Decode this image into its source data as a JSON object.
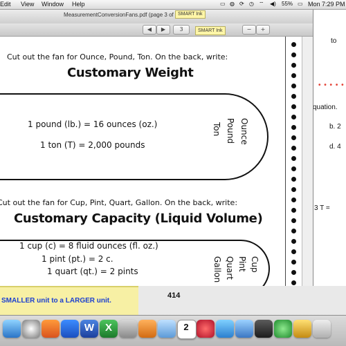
{
  "menubar": {
    "items": [
      "Edit",
      "View",
      "Window",
      "Help"
    ],
    "battery": "55%",
    "clock": "Mon 7:29 PM"
  },
  "background_doc": {
    "frag_top": "to",
    "frag_equation": "quation.",
    "item_b": "b. 2",
    "item_d": "d. 4",
    "frag_3t": "3 T ="
  },
  "window": {
    "title": "MeasurementConversionFans.pdf (page 3 of 12)",
    "smart_ink_tab": "SMART Ink",
    "smart_ink_label": "SMART Ink",
    "toolbar_page_field": "3"
  },
  "page": {
    "weight": {
      "instruction": "Cut out the fan for Ounce, Pound, Ton.  On the back, write:",
      "heading": "Customary Weight",
      "line1": "1 pound (lb.) = 16 ounces (oz.)",
      "line2": "1 ton (T) = 2,000 pounds",
      "tab_words": [
        "Ounce",
        "Pound",
        "Ton"
      ]
    },
    "capacity": {
      "instruction": "Cut out the fan for Cup, Pint, Quart, Gallon.  On the back, write:",
      "heading": "Customary Capacity (Liquid Volume)",
      "line1": "1 cup (c) = 8 fluid ounces (fl. oz.)",
      "line2": "1 pint (pt.) = 2 c.",
      "line3": "1 quart (qt.) = 2 pints",
      "tab_words": [
        "Cup",
        "Pint",
        "Quart",
        "Gallon"
      ]
    }
  },
  "banner": {
    "text": "SMALLER unit to a LARGER unit."
  },
  "page_number": "414",
  "dock": {
    "calendar_day": "2",
    "spreadsheet_letter": "X",
    "doc_letter": "W"
  }
}
